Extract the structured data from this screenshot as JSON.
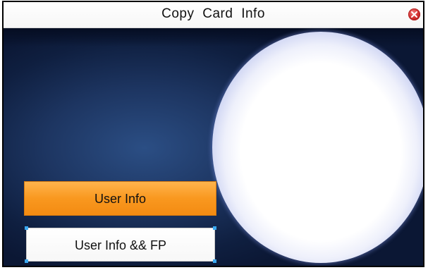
{
  "window": {
    "title": "Copy Card Info"
  },
  "menu": {
    "items": [
      {
        "label": "User Info",
        "selected": true
      },
      {
        "label": "User Info && FP",
        "selected": false
      }
    ]
  },
  "icons": {
    "close": "close-icon"
  },
  "colors": {
    "selected_button": "#f9981f",
    "background": "#1d3561",
    "orb_edge": "#7281cf"
  }
}
